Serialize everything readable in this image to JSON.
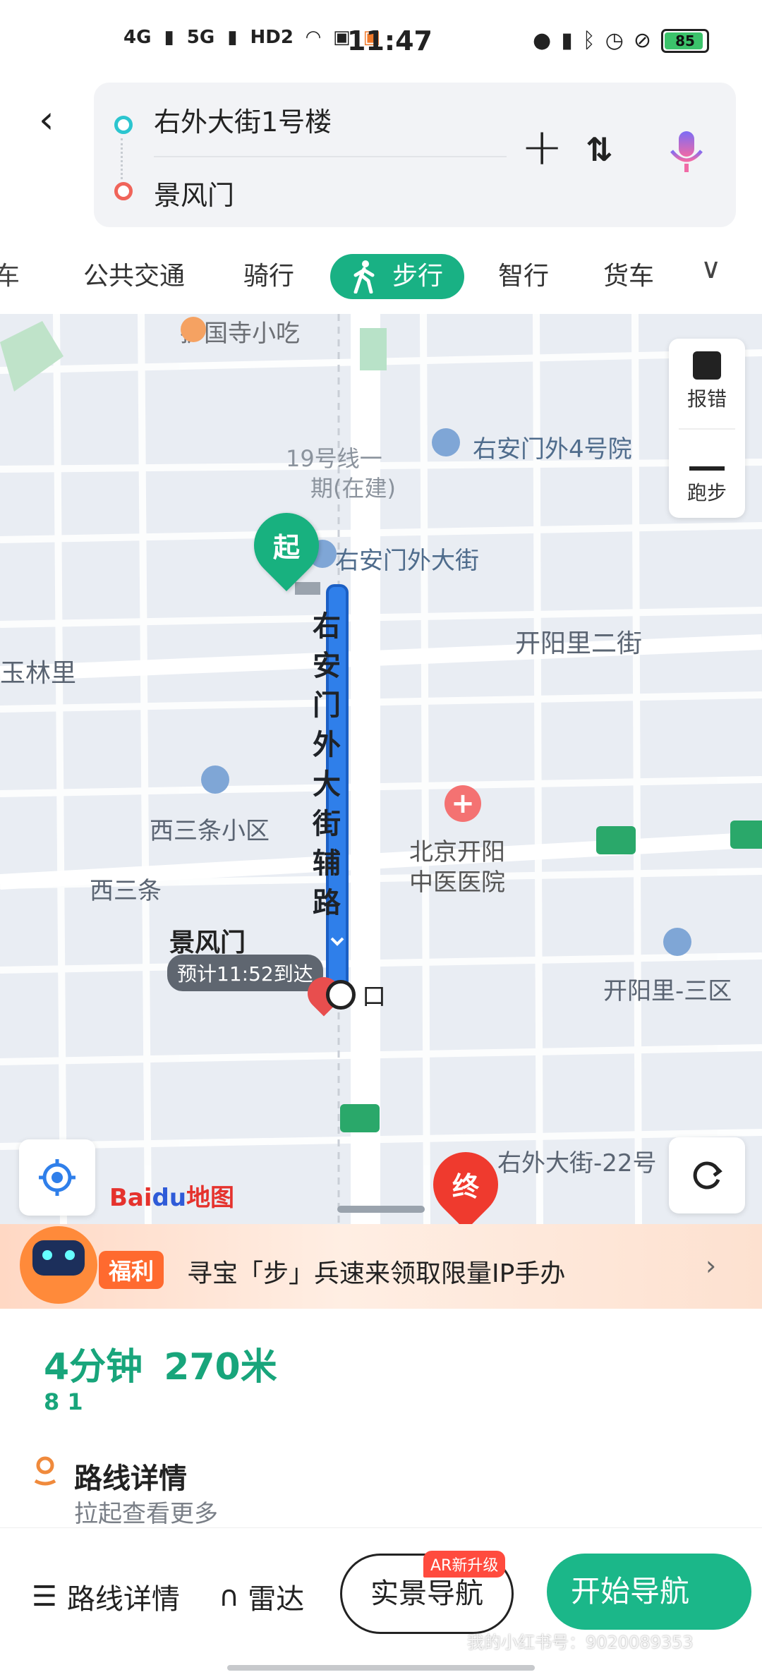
{
  "status_bar": {
    "network1": "4G",
    "network2": "5G",
    "hd": "HD2",
    "time": "11:47",
    "battery": "85"
  },
  "route": {
    "start": "右外大街1号楼",
    "end": "景风门"
  },
  "modes": {
    "partial": "车",
    "transit": "公共交通",
    "bike": "骑行",
    "walk": "步行",
    "smart": "智行",
    "truck": "货车"
  },
  "map": {
    "poi_hgs": "护国寺小吃",
    "line19": "19号线一",
    "line19_b": "期(在建)",
    "poi_4yuan": "右安门外4号院",
    "poi_street": "右安门外大街",
    "start_marker": "起",
    "end_marker": "终",
    "road_vertical": "右安门外大街辅路",
    "road_kyl2": "开阳里二街",
    "area_yll": "玉林里",
    "area_xsq": "西三条小区",
    "road_xst": "西三条",
    "hospital_1": "北京开阳",
    "hospital_2": "中医医院",
    "dest_name": "景风门",
    "eta": "预计11:52到达",
    "poi_kou": "口",
    "area_kyl3": "开阳里-三区",
    "poi_22": "右外大街-22号",
    "side_report": "报错",
    "side_run": "跑步",
    "logo_bai": "Bai",
    "logo_du": "du",
    "logo_map": "地图"
  },
  "promo": {
    "badge": "福利",
    "text": "寻宝「步」兵速来领取限量IP手办"
  },
  "summary": {
    "time": "4分钟",
    "distance": "270米",
    "lights": "1",
    "detail_title": "路线详情",
    "detail_sub": "拉起查看更多"
  },
  "bottom": {
    "detail": "路线详情",
    "radar": "雷达",
    "ar_nav": "实景导航",
    "ar_badge": "AR新升级",
    "start_nav": "开始导航",
    "watermark": "我的小红书号：9020089353"
  }
}
